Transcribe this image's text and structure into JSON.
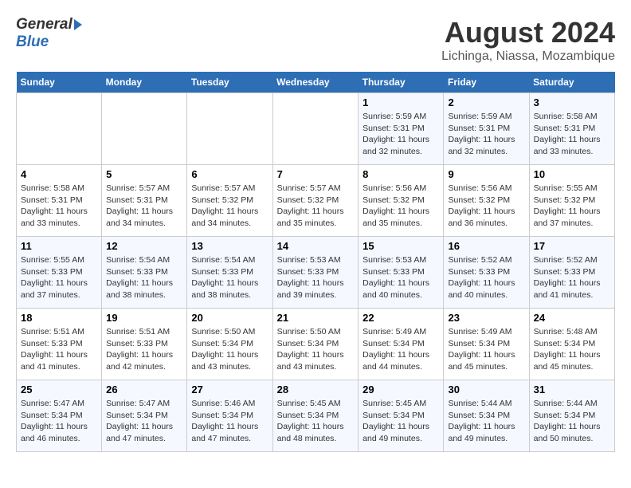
{
  "header": {
    "logo_general": "General",
    "logo_blue": "Blue",
    "title": "August 2024",
    "subtitle": "Lichinga, Niassa, Mozambique"
  },
  "days_of_week": [
    "Sunday",
    "Monday",
    "Tuesday",
    "Wednesday",
    "Thursday",
    "Friday",
    "Saturday"
  ],
  "weeks": [
    {
      "days": [
        {
          "num": "",
          "info": ""
        },
        {
          "num": "",
          "info": ""
        },
        {
          "num": "",
          "info": ""
        },
        {
          "num": "",
          "info": ""
        },
        {
          "num": "1",
          "info": "Sunrise: 5:59 AM\nSunset: 5:31 PM\nDaylight: 11 hours\nand 32 minutes."
        },
        {
          "num": "2",
          "info": "Sunrise: 5:59 AM\nSunset: 5:31 PM\nDaylight: 11 hours\nand 32 minutes."
        },
        {
          "num": "3",
          "info": "Sunrise: 5:58 AM\nSunset: 5:31 PM\nDaylight: 11 hours\nand 33 minutes."
        }
      ]
    },
    {
      "days": [
        {
          "num": "4",
          "info": "Sunrise: 5:58 AM\nSunset: 5:31 PM\nDaylight: 11 hours\nand 33 minutes."
        },
        {
          "num": "5",
          "info": "Sunrise: 5:57 AM\nSunset: 5:31 PM\nDaylight: 11 hours\nand 34 minutes."
        },
        {
          "num": "6",
          "info": "Sunrise: 5:57 AM\nSunset: 5:32 PM\nDaylight: 11 hours\nand 34 minutes."
        },
        {
          "num": "7",
          "info": "Sunrise: 5:57 AM\nSunset: 5:32 PM\nDaylight: 11 hours\nand 35 minutes."
        },
        {
          "num": "8",
          "info": "Sunrise: 5:56 AM\nSunset: 5:32 PM\nDaylight: 11 hours\nand 35 minutes."
        },
        {
          "num": "9",
          "info": "Sunrise: 5:56 AM\nSunset: 5:32 PM\nDaylight: 11 hours\nand 36 minutes."
        },
        {
          "num": "10",
          "info": "Sunrise: 5:55 AM\nSunset: 5:32 PM\nDaylight: 11 hours\nand 37 minutes."
        }
      ]
    },
    {
      "days": [
        {
          "num": "11",
          "info": "Sunrise: 5:55 AM\nSunset: 5:33 PM\nDaylight: 11 hours\nand 37 minutes."
        },
        {
          "num": "12",
          "info": "Sunrise: 5:54 AM\nSunset: 5:33 PM\nDaylight: 11 hours\nand 38 minutes."
        },
        {
          "num": "13",
          "info": "Sunrise: 5:54 AM\nSunset: 5:33 PM\nDaylight: 11 hours\nand 38 minutes."
        },
        {
          "num": "14",
          "info": "Sunrise: 5:53 AM\nSunset: 5:33 PM\nDaylight: 11 hours\nand 39 minutes."
        },
        {
          "num": "15",
          "info": "Sunrise: 5:53 AM\nSunset: 5:33 PM\nDaylight: 11 hours\nand 40 minutes."
        },
        {
          "num": "16",
          "info": "Sunrise: 5:52 AM\nSunset: 5:33 PM\nDaylight: 11 hours\nand 40 minutes."
        },
        {
          "num": "17",
          "info": "Sunrise: 5:52 AM\nSunset: 5:33 PM\nDaylight: 11 hours\nand 41 minutes."
        }
      ]
    },
    {
      "days": [
        {
          "num": "18",
          "info": "Sunrise: 5:51 AM\nSunset: 5:33 PM\nDaylight: 11 hours\nand 41 minutes."
        },
        {
          "num": "19",
          "info": "Sunrise: 5:51 AM\nSunset: 5:33 PM\nDaylight: 11 hours\nand 42 minutes."
        },
        {
          "num": "20",
          "info": "Sunrise: 5:50 AM\nSunset: 5:34 PM\nDaylight: 11 hours\nand 43 minutes."
        },
        {
          "num": "21",
          "info": "Sunrise: 5:50 AM\nSunset: 5:34 PM\nDaylight: 11 hours\nand 43 minutes."
        },
        {
          "num": "22",
          "info": "Sunrise: 5:49 AM\nSunset: 5:34 PM\nDaylight: 11 hours\nand 44 minutes."
        },
        {
          "num": "23",
          "info": "Sunrise: 5:49 AM\nSunset: 5:34 PM\nDaylight: 11 hours\nand 45 minutes."
        },
        {
          "num": "24",
          "info": "Sunrise: 5:48 AM\nSunset: 5:34 PM\nDaylight: 11 hours\nand 45 minutes."
        }
      ]
    },
    {
      "days": [
        {
          "num": "25",
          "info": "Sunrise: 5:47 AM\nSunset: 5:34 PM\nDaylight: 11 hours\nand 46 minutes."
        },
        {
          "num": "26",
          "info": "Sunrise: 5:47 AM\nSunset: 5:34 PM\nDaylight: 11 hours\nand 47 minutes."
        },
        {
          "num": "27",
          "info": "Sunrise: 5:46 AM\nSunset: 5:34 PM\nDaylight: 11 hours\nand 47 minutes."
        },
        {
          "num": "28",
          "info": "Sunrise: 5:45 AM\nSunset: 5:34 PM\nDaylight: 11 hours\nand 48 minutes."
        },
        {
          "num": "29",
          "info": "Sunrise: 5:45 AM\nSunset: 5:34 PM\nDaylight: 11 hours\nand 49 minutes."
        },
        {
          "num": "30",
          "info": "Sunrise: 5:44 AM\nSunset: 5:34 PM\nDaylight: 11 hours\nand 49 minutes."
        },
        {
          "num": "31",
          "info": "Sunrise: 5:44 AM\nSunset: 5:34 PM\nDaylight: 11 hours\nand 50 minutes."
        }
      ]
    }
  ]
}
